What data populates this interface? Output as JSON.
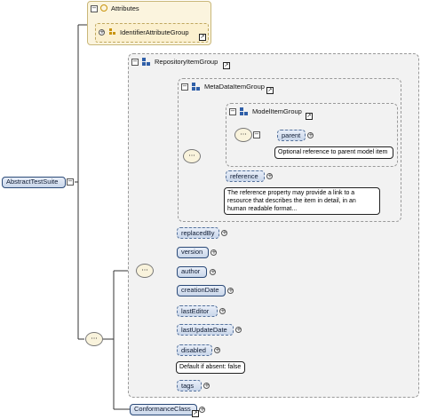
{
  "root": {
    "label": "AbstractTestSuite"
  },
  "attributes": {
    "title": "Attributes",
    "group_label": "IdentifierAttributeGroup"
  },
  "repository_group": {
    "label": "RepositoryItemGroup"
  },
  "metadata_group": {
    "label": "MetaDataItemGroup"
  },
  "model_group": {
    "label": "ModelItemGroup"
  },
  "elements": {
    "parent": {
      "label": "parent",
      "doc": "Optional reference to parent model item"
    },
    "reference": {
      "label": "reference",
      "doc_lines": [
        "The reference property may provide a link to a",
        "resource that describes the item in detail, in an",
        "human readable format..."
      ]
    },
    "replacedBy": {
      "label": "replacedBy"
    },
    "version": {
      "label": "version"
    },
    "author": {
      "label": "author"
    },
    "creationDate": {
      "label": "creationDate"
    },
    "lastEditor": {
      "label": "lastEditor"
    },
    "lastUpdateDate": {
      "label": "lastUpdateDate"
    },
    "disabled": {
      "label": "disabled",
      "doc": "Default if absent: false"
    },
    "tags": {
      "label": "tags"
    },
    "conformanceClass": {
      "label": "ConformanceClass"
    }
  },
  "icons": {
    "expand": "+",
    "collapse": "−",
    "reference_arrow": "↗",
    "sequence": "···"
  },
  "colors": {
    "node_border": "#2b4a78",
    "attributes_bg": "#fbf4de",
    "group_bg": "#f2f2f2",
    "group_icon": "#2f5fa8",
    "attribute_icon": "#c8930c"
  }
}
